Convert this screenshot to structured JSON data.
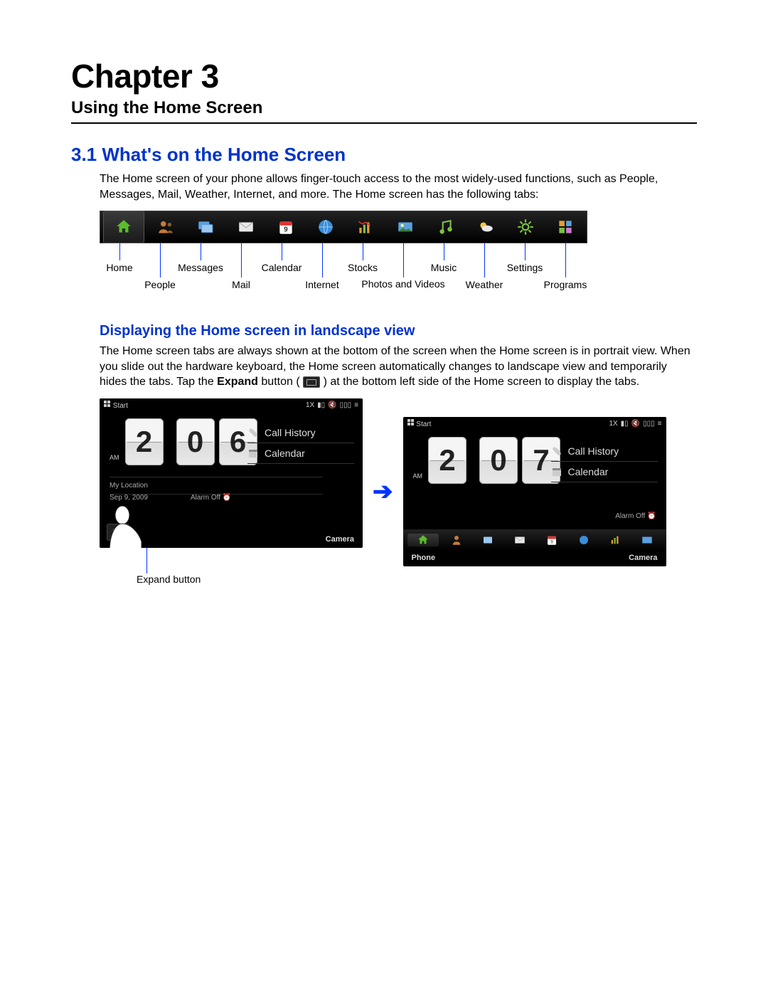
{
  "chapter_title": "Chapter 3",
  "chapter_subtitle": "Using the Home Screen",
  "section_title": "3.1  What's on the Home Screen",
  "intro_para": "The Home screen of your phone allows finger-touch access to the most widely-used functions, such as People, Messages, Mail, Weather, Internet, and more. The Home screen has the following tabs:",
  "tabs": [
    {
      "name": "Home"
    },
    {
      "name": "People"
    },
    {
      "name": "Messages"
    },
    {
      "name": "Mail"
    },
    {
      "name": "Calendar"
    },
    {
      "name": "Internet"
    },
    {
      "name": "Stocks"
    },
    {
      "name": "Photos and Videos"
    },
    {
      "name": "Music"
    },
    {
      "name": "Weather"
    },
    {
      "name": "Settings"
    },
    {
      "name": "Programs"
    }
  ],
  "subsection_title": "Displaying the Home screen in landscape view",
  "landscape_para_1": "The Home screen tabs are always shown at the bottom of the screen when the Home screen is in portrait view. When you slide out the hardware keyboard, the Home screen automatically changes to landscape view and temporarily hides the tabs. Tap the ",
  "landscape_para_bold": "Expand",
  "landscape_para_2": " button (",
  "landscape_para_3": ") at the bottom left side of the Home screen to display the tabs.",
  "phone_left": {
    "start": "Start",
    "clock_h": "2",
    "clock_m1": "0",
    "clock_m2": "6",
    "ampm": "AM",
    "link1": "Call History",
    "link2": "Calendar",
    "location": "My Location",
    "date": "Sep 9, 2009",
    "alarm": "Alarm Off",
    "camera": "Camera"
  },
  "phone_right": {
    "start": "Start",
    "clock_h": "2",
    "clock_m1": "0",
    "clock_m2": "7",
    "ampm": "AM",
    "link1": "Call History",
    "link2": "Calendar",
    "alarm": "Alarm Off",
    "phone": "Phone",
    "camera": "Camera"
  },
  "expand_label": "Expand button"
}
